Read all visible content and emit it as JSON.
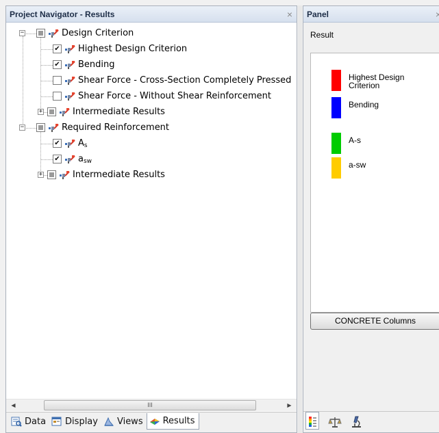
{
  "navigator": {
    "title": "Project Navigator - Results",
    "close_glyph": "×",
    "tree": [
      {
        "label": "Design Criterion",
        "sub": "",
        "state": "partial",
        "expander": "−"
      },
      {
        "label": "Highest Design Criterion",
        "sub": "",
        "state": "checked"
      },
      {
        "label": "Bending",
        "sub": "",
        "state": "checked"
      },
      {
        "label": "Shear Force - Cross-Section Completely Pressed",
        "sub": "",
        "state": "unchecked"
      },
      {
        "label": "Shear Force - Without Shear Reinforcement",
        "sub": "",
        "state": "unchecked"
      },
      {
        "label": "Intermediate Results",
        "sub": "",
        "state": "partial",
        "expander": "+"
      },
      {
        "label": "Required Reinforcement",
        "sub": "",
        "state": "partial",
        "expander": "−"
      },
      {
        "label": "A",
        "sub": "s",
        "state": "checked"
      },
      {
        "label": "a",
        "sub": "sw",
        "state": "checked"
      },
      {
        "label": "Intermediate Results",
        "sub": "",
        "state": "partial",
        "expander": "+"
      }
    ],
    "scrollbar": {
      "left_arrow": "◀",
      "right_arrow": "▶",
      "grip": "III"
    },
    "tabs": [
      {
        "label": "Data",
        "icon": "data-icon"
      },
      {
        "label": "Display",
        "icon": "display-icon"
      },
      {
        "label": "Views",
        "icon": "views-icon"
      },
      {
        "label": "Results",
        "icon": "results-icon",
        "active": true
      }
    ]
  },
  "panel": {
    "title": "Panel",
    "close_glyph": "×",
    "result_label": "Result",
    "legend": [
      {
        "label": "Highest Design Criterion",
        "color": "#ff0000"
      },
      {
        "label": "Bending",
        "color": "#0000ff"
      },
      {
        "label": "A-s",
        "color": "#00cc00"
      },
      {
        "label": "a-sw",
        "color": "#ffcc00"
      }
    ],
    "button_label": "CONCRETE Columns",
    "tools": [
      "color-scale-icon",
      "balance-icon",
      "microscope-icon"
    ]
  }
}
